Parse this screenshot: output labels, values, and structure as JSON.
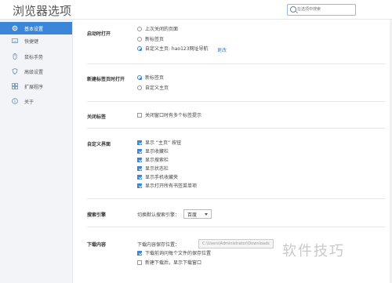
{
  "window": {
    "title": "浏览器选项"
  },
  "search": {
    "placeholder": "在选项中搜索"
  },
  "sidebar": {
    "items": [
      {
        "label": "基本设置",
        "icon": "gear-icon",
        "active": true
      },
      {
        "label": "快捷键",
        "icon": "keyboard-icon",
        "active": false
      },
      {
        "label": "鼠标手势",
        "icon": "mouse-icon",
        "active": false
      },
      {
        "label": "高级设置",
        "icon": "shield-icon",
        "active": false
      },
      {
        "label": "扩展程序",
        "icon": "puzzle-icon",
        "active": false
      },
      {
        "label": "关于",
        "icon": "info-icon",
        "active": false
      }
    ]
  },
  "startup": {
    "label": "启动时打开",
    "options": [
      "上次关闭的页面",
      "新标签页",
      "自定义主页: hao123网址导航"
    ],
    "selected": 2,
    "change_link": "更改"
  },
  "newtab": {
    "label": "新建标签页时打开",
    "options": [
      "新标签页",
      "自定义主页"
    ],
    "selected": 0
  },
  "close_tab": {
    "label": "关闭标签",
    "option": "关闭窗口时有多个标签提示",
    "checked": false
  },
  "custom_ui": {
    "label": "自定义界面",
    "options": [
      {
        "text": "显示 “主页” 按钮",
        "checked": true
      },
      {
        "text": "显示收藏栏",
        "checked": true
      },
      {
        "text": "显示搜索栏",
        "checked": true
      },
      {
        "text": "显示状态栏",
        "checked": true
      },
      {
        "text": "显示手机收藏夹",
        "checked": true
      },
      {
        "text": "显示打开所有书签菜单项",
        "checked": true
      }
    ]
  },
  "search_engine": {
    "label": "搜索引擎",
    "switch_label": "切换默认搜索引擎：",
    "selected": "百度"
  },
  "download": {
    "label": "下载内容",
    "path_label": "下载内容保存位置：",
    "path_value": "C:\\Users\\Administrator\\Downloads",
    "options": [
      {
        "text": "下载前询问每个文件的保存位置",
        "checked": true
      },
      {
        "text": "新建下载后，显示下载窗口",
        "checked": false
      }
    ]
  },
  "watermark": "软件技巧",
  "colors": {
    "accent": "#3b86d8",
    "sidebar_bg": "#f2f4f8"
  }
}
